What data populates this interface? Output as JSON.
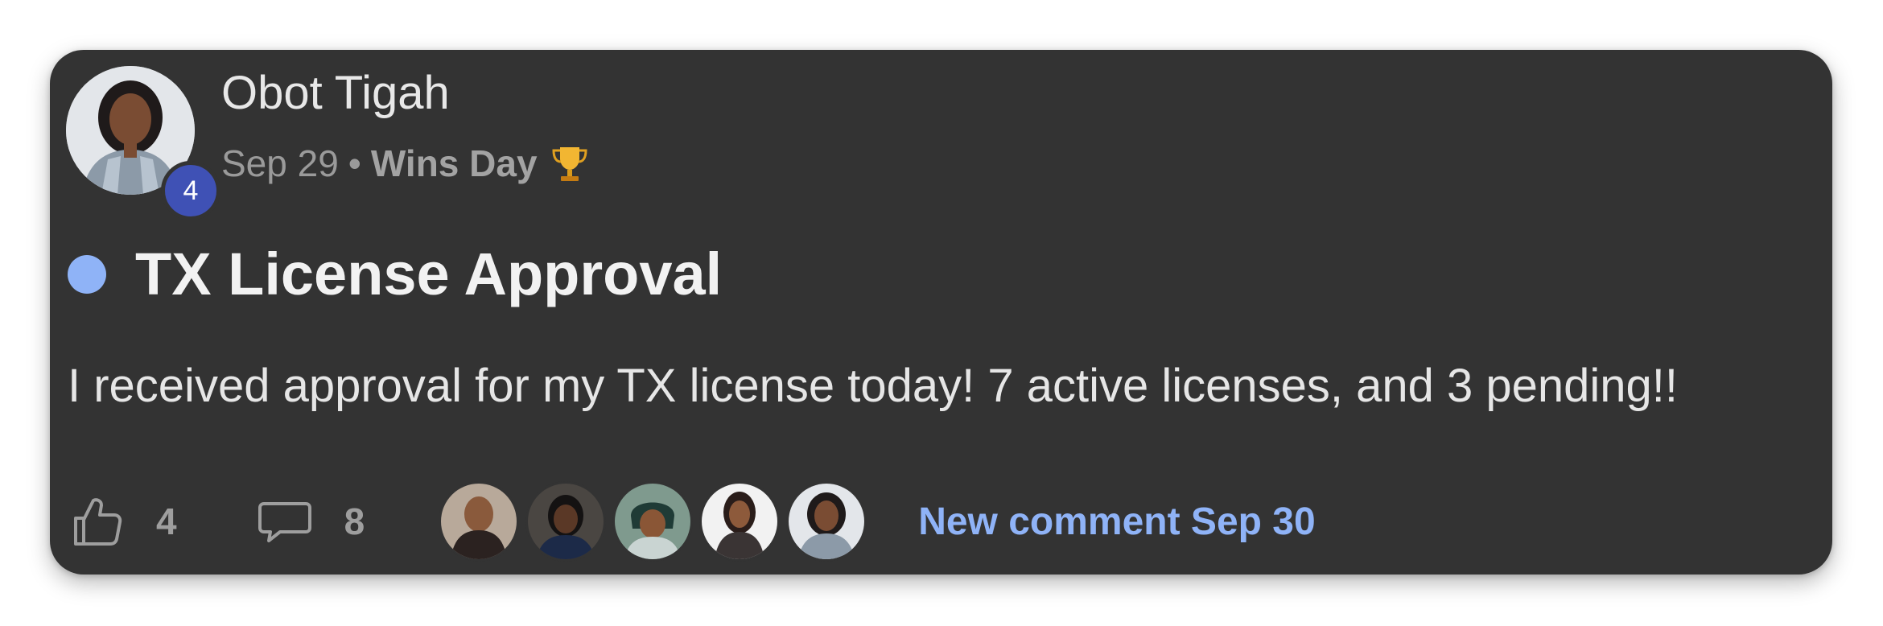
{
  "post": {
    "author": "Obot Tigah",
    "level": "4",
    "date": "Sep 29",
    "separator": "•",
    "category": "Wins Day",
    "category_icon": "trophy-icon",
    "title": "TX License Approval",
    "body": "I received approval for my TX license today! 7 active licenses, and 3 pending!!",
    "unread_color": "#8fb3f7"
  },
  "footer": {
    "likes": "4",
    "comments": "8",
    "commenter_avatars": [
      "commenter-1",
      "commenter-2",
      "commenter-3",
      "commenter-4",
      "commenter-5"
    ],
    "last_comment": "New comment Sep 30"
  },
  "colors": {
    "card_bg": "#333333",
    "accent_blue": "#8fb3f7",
    "badge_bg": "#3f51b5"
  }
}
